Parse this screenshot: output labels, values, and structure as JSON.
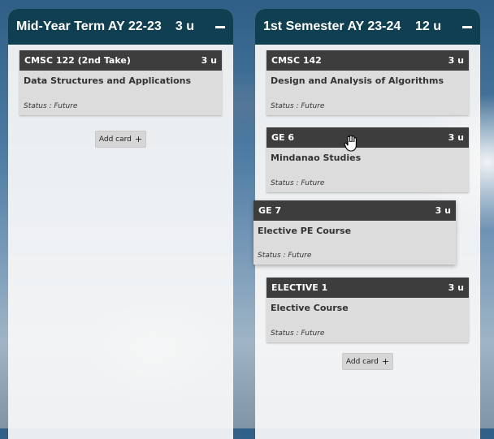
{
  "columns": [
    {
      "title": "Mid-Year Term AY 22-23",
      "units": "3 u",
      "add_card_label": "Add card",
      "add_card_icon": "+",
      "cards": [
        {
          "code": "CMSC 122 (2nd Take)",
          "units": "3 u",
          "title": "Data Structures and Applications",
          "status": "Status : Future"
        }
      ]
    },
    {
      "title": "1st Semester AY 23-24",
      "units": "12 u",
      "add_card_label": "Add card",
      "add_card_icon": "+",
      "cards": [
        {
          "code": "CMSC 142",
          "units": "3 u",
          "title": "Design and Analysis of Algorithms",
          "status": "Status : Future"
        },
        {
          "code": "GE 6",
          "units": "3 u",
          "title": "Mindanao Studies",
          "status": "Status : Future"
        },
        {
          "code": "GE 7",
          "units": "3 u",
          "title": "Elective PE Course",
          "status": "Status : Future"
        },
        {
          "code": "ELECTIVE 1",
          "units": "3 u",
          "title": "Elective Course",
          "status": "Status : Future"
        }
      ]
    }
  ],
  "icons": {
    "collapse": "minus-icon",
    "cursor": "hand-pointer-icon"
  },
  "colors": {
    "header_bg": "#0f3f51",
    "card_head_bg": "#3d3d3d",
    "card_bg": "#dcdcdc"
  }
}
